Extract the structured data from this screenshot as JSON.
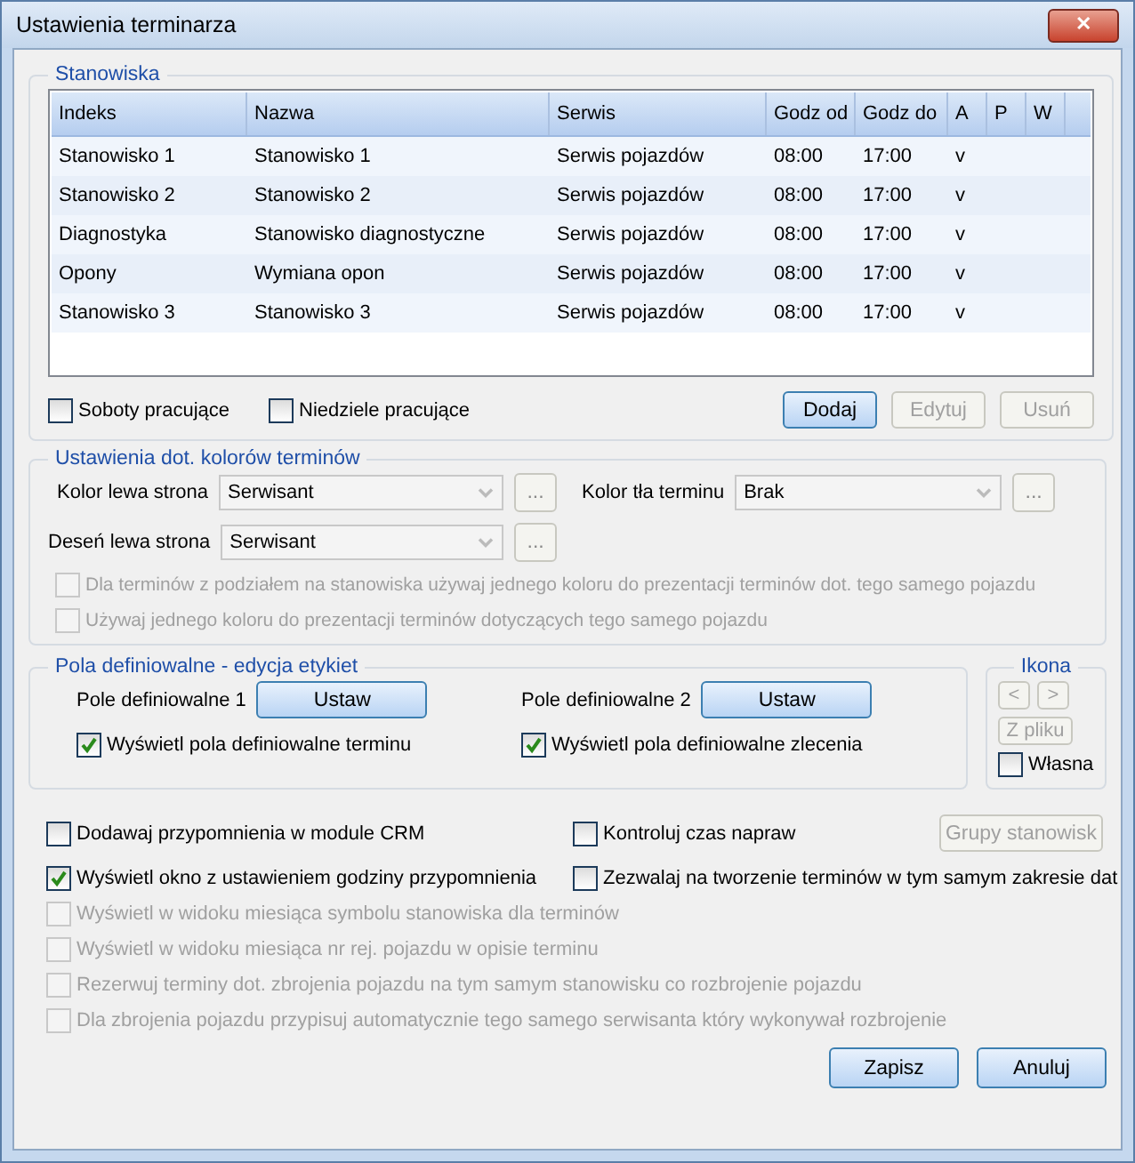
{
  "window": {
    "title": "Ustawienia terminarza",
    "close": "✕"
  },
  "stations": {
    "title": "Stanowiska",
    "columns": [
      "Indeks",
      "Nazwa",
      "Serwis",
      "Godz od",
      "Godz do",
      "A",
      "P",
      "W"
    ],
    "rows": [
      [
        "Stanowisko 1",
        "Stanowisko 1",
        "Serwis pojazdów",
        "08:00",
        "17:00",
        "v"
      ],
      [
        "Stanowisko 2",
        "Stanowisko 2",
        "Serwis pojazdów",
        "08:00",
        "17:00",
        "v"
      ],
      [
        "Diagnostyka",
        "Stanowisko diagnostyczne",
        "Serwis pojazdów",
        "08:00",
        "17:00",
        "v"
      ],
      [
        "Opony",
        "Wymiana opon",
        "Serwis pojazdów",
        "08:00",
        "17:00",
        "v"
      ],
      [
        "Stanowisko 3",
        "Stanowisko 3",
        "Serwis pojazdów",
        "08:00",
        "17:00",
        "v"
      ]
    ],
    "checkboxes": [
      {
        "label": "Soboty pracujące",
        "checked": false
      },
      {
        "label": "Niedziele pracujące",
        "checked": false
      }
    ],
    "buttons": [
      {
        "label": "Dodaj",
        "disabled": false
      },
      {
        "label": "Edytuj",
        "disabled": true
      },
      {
        "label": "Usuń",
        "disabled": true
      }
    ]
  },
  "colors": {
    "title": "Ustawienia dot. kolorów terminów",
    "fields": [
      {
        "label": "Kolor lewa strona",
        "value": "Serwisant",
        "more": "..."
      },
      {
        "label": "Kolor tła terminu",
        "value": "Brak",
        "more": "..."
      },
      {
        "label": "Deseń lewa strona",
        "value": "Serwisant",
        "more": "..."
      }
    ],
    "checkboxes": [
      {
        "label": "Dla terminów z podziałem na stanowiska używaj jednego koloru do prezentacji terminów dot. tego samego pojazdu",
        "checked": false,
        "disabled": true
      },
      {
        "label": "Używaj jednego koloru do prezentacji terminów dotyczących tego samego pojazdu",
        "checked": false,
        "disabled": true
      }
    ]
  },
  "custom_fields": {
    "title": "Pola definiowalne - edycja etykiet",
    "items": [
      {
        "label": "Pole definiowalne 1",
        "button": "Ustaw",
        "checkbox": {
          "label": "Wyświetl pola definiowalne terminu",
          "checked": true
        }
      },
      {
        "label": "Pole definiowalne 2",
        "button": "Ustaw",
        "checkbox": {
          "label": "Wyświetl pola definiowalne zlecenia",
          "checked": true
        }
      }
    ]
  },
  "icon": {
    "title": "Ikona",
    "buttons": [
      {
        "label": "<",
        "disabled": true
      },
      {
        "label": ">",
        "disabled": true
      },
      {
        "label": "Z pliku",
        "disabled": true
      }
    ],
    "checkbox": {
      "label": "Własna",
      "checked": false
    }
  },
  "options": {
    "grid": [
      {
        "label": "Dodawaj przypomnienia w module CRM",
        "checked": false,
        "disabled": false
      },
      {
        "label": "Kontroluj czas napraw",
        "checked": false,
        "disabled": false
      },
      {
        "label": "Wyświetl okno z ustawieniem godziny przypomnienia",
        "checked": true,
        "disabled": false
      },
      {
        "label": "Zezwalaj na tworzenie terminów w tym samym zakresie dat",
        "checked": false,
        "disabled": false
      }
    ],
    "groups_button": {
      "label": "Grupy stanowisk",
      "disabled": true
    },
    "list": [
      {
        "label": "Wyświetl w widoku miesiąca symbolu stanowiska dla terminów",
        "checked": false,
        "disabled": true
      },
      {
        "label": "Wyświetl w widoku miesiąca nr rej. pojazdu w opisie terminu",
        "checked": false,
        "disabled": true
      },
      {
        "label": "Rezerwuj terminy dot. zbrojenia pojazdu na tym samym stanowisku co rozbrojenie pojazdu",
        "checked": false,
        "disabled": true
      },
      {
        "label": "Dla zbrojenia pojazdu przypisuj automatycznie tego samego serwisanta który wykonywał rozbrojenie",
        "checked": false,
        "disabled": true
      }
    ]
  },
  "footer": [
    {
      "label": "Zapisz"
    },
    {
      "label": "Anuluj"
    }
  ]
}
